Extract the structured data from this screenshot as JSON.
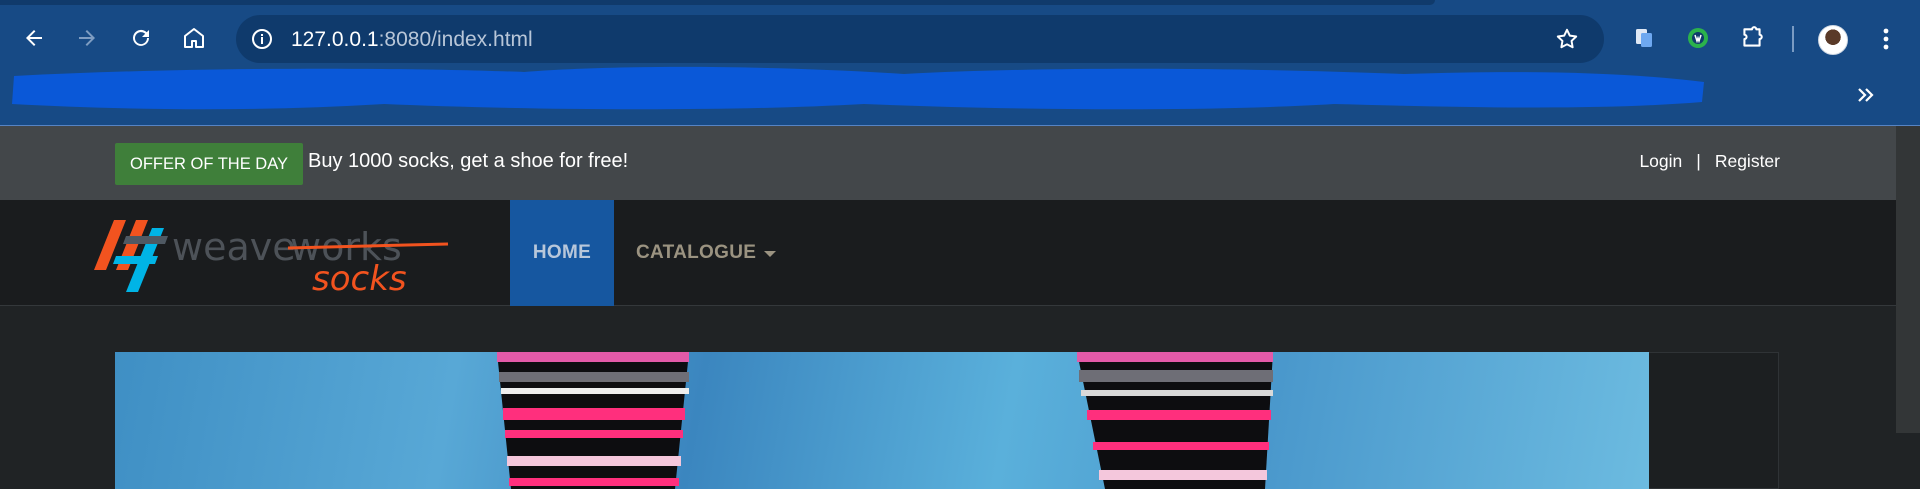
{
  "browser": {
    "url_host": "127.0.0.1",
    "url_rest": ":8080/index.html",
    "icons": {
      "back": "arrow-left-icon",
      "forward": "arrow-right-icon",
      "reload": "reload-icon",
      "home": "home-icon",
      "site_info": "info-icon",
      "bookmark": "star-icon",
      "extensions": "puzzle-icon",
      "menu": "kebab-icon",
      "more_bookmarks": "chevron-double-right-icon"
    },
    "colors": {
      "chrome": "#174a85",
      "omnibox": "#0f3a6c",
      "redaction": "#0a58d8"
    }
  },
  "site": {
    "offer_badge": "OFFER OF THE DAY",
    "offer_text": "Buy 1000 socks, get a shoe for free!",
    "login": "Login",
    "separator": "|",
    "register": "Register",
    "logo_alt": "weaveworks socks",
    "nav": {
      "home": "HOME",
      "catalogue": "CATALOGUE"
    },
    "colors": {
      "topbar": "#43474a",
      "offer_badge": "#3f7f3a",
      "navbar": "#1a1c1e",
      "active_nav": "#1657a0",
      "logo_orange": "#f2531f",
      "logo_cyan": "#00b4e6"
    }
  }
}
